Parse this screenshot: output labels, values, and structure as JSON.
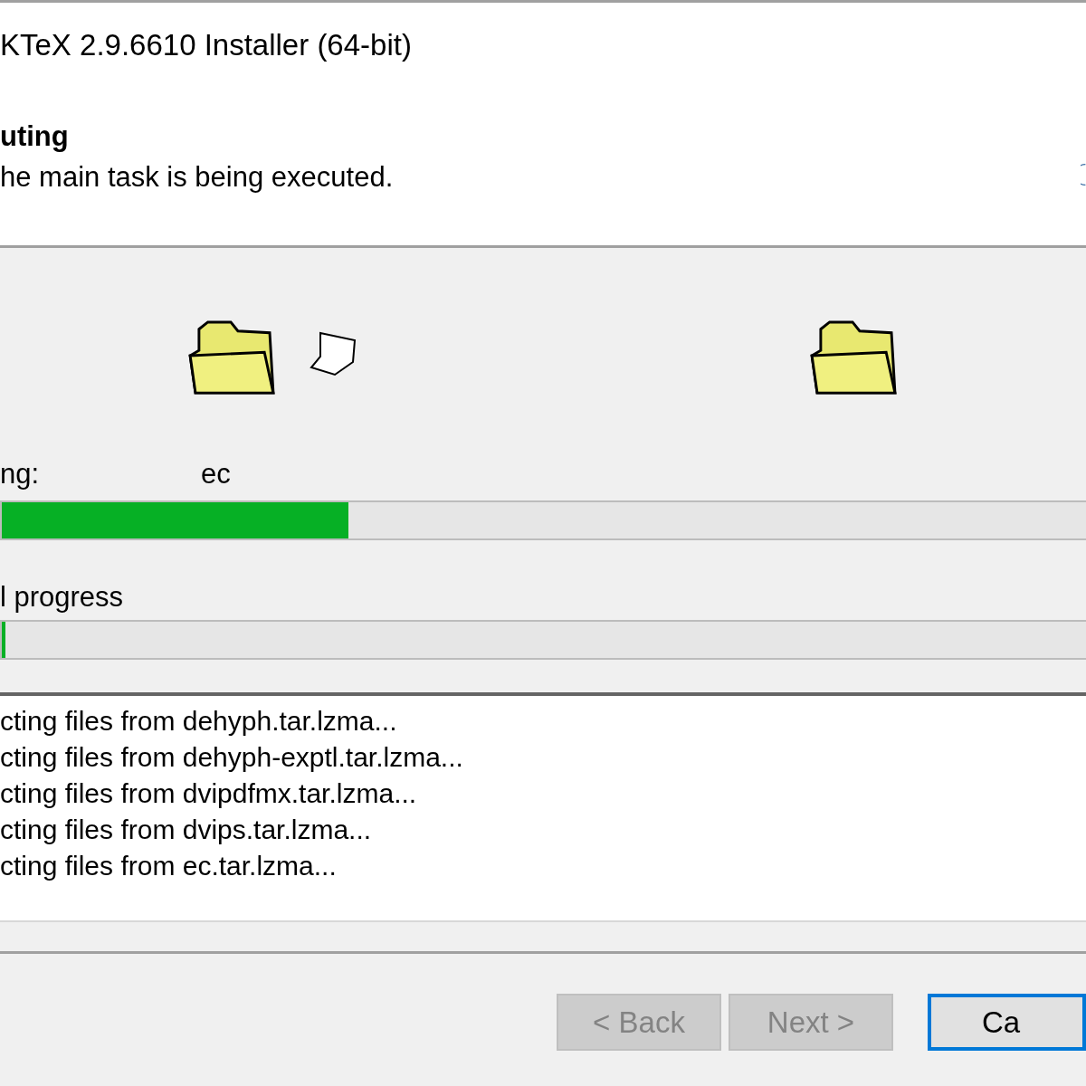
{
  "window": {
    "title": "KTeX 2.9.6610 Installer (64-bit)"
  },
  "header": {
    "heading": "uting",
    "subtitle": "he main task is being executed."
  },
  "current": {
    "label": "ng:",
    "package": "ec",
    "level": 0.32
  },
  "overall": {
    "label": "l progress",
    "level": 0.003
  },
  "log": [
    "cting files from dehyph.tar.lzma...",
    "cting files from dehyph-exptl.tar.lzma...",
    "cting files from dvipdfmx.tar.lzma...",
    "cting files from dvips.tar.lzma...",
    "cting files from ec.tar.lzma..."
  ],
  "buttons": [
    {
      "label": "< Back",
      "disabled": true,
      "focused": false
    },
    {
      "label": "Next >",
      "disabled": true,
      "focused": false
    },
    {
      "label": "Ca",
      "disabled": false,
      "focused": true
    }
  ]
}
